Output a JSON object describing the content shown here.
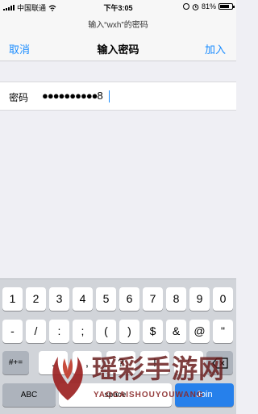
{
  "status_bar": {
    "carrier": "中国联通",
    "time": "下午3:05",
    "battery": "81%",
    "battery_level": 0.81
  },
  "header": {
    "prompt": "输入“wxh”的密码",
    "cancel_label": "取消",
    "title": "输入密码",
    "add_label": "加入"
  },
  "password_field": {
    "label": "密码",
    "value": "●●●●●●●●●●8"
  },
  "keyboard": {
    "row1": [
      "1",
      "2",
      "3",
      "4",
      "5",
      "6",
      "7",
      "8",
      "9",
      "0"
    ],
    "row2": [
      "-",
      "/",
      ":",
      ";",
      "(",
      ")",
      "$",
      "&",
      "@",
      "\""
    ],
    "row3_left": "#+=",
    "row3": [
      ".",
      ",",
      "?",
      "!",
      "'"
    ],
    "abc_label": "ABC",
    "space_label": "space",
    "join_label": "Join"
  },
  "watermark": {
    "chinese": "瑶彩手游网",
    "pinyin": "YAOCAISHOUYOUWANG"
  },
  "colors": {
    "accent": "#1a8cff",
    "join_key": "#2680eb",
    "watermark": "#6b1f1f"
  }
}
